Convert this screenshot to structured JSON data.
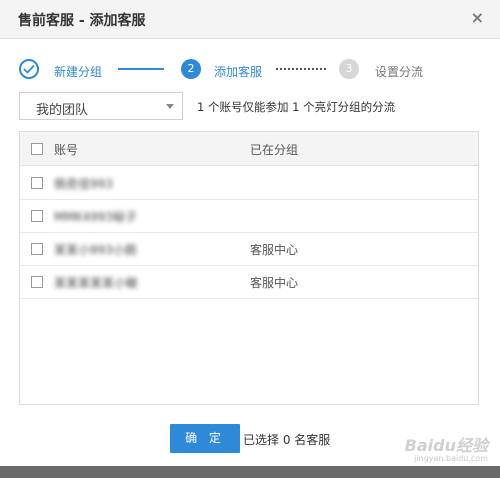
{
  "dialog": {
    "title": "售前客服 - 添加客服",
    "close_glyph": "×"
  },
  "steps": [
    {
      "number": "",
      "label": "新建分组",
      "state": "done"
    },
    {
      "number": "2",
      "label": "添加客服",
      "state": "active"
    },
    {
      "number": "3",
      "label": "设置分流",
      "state": "pending"
    }
  ],
  "team_select": {
    "value": "我的团队"
  },
  "hint": "1 个账号仅能参加 1 个亮灯分组的分流",
  "table": {
    "headers": {
      "account": "账号",
      "group": "已在分组"
    },
    "rows": [
      {
        "account": "佩奇佳993",
        "group": ""
      },
      {
        "account": "MMK4993秘子",
        "group": ""
      },
      {
        "account": "某某小993小鹃",
        "group": "客服中心"
      },
      {
        "account": "某某某某某小敏",
        "group": "客服中心"
      }
    ]
  },
  "footer": {
    "confirm_label": "确 定",
    "selected_text": "已选择 0 名客服"
  },
  "watermark": {
    "text": "Baidu经验",
    "sub": "jingyan.baidu.com"
  },
  "colors": {
    "accent": "#2e8ad8",
    "header_bg": "#f4f4f4",
    "pending": "#d6d6d6"
  }
}
